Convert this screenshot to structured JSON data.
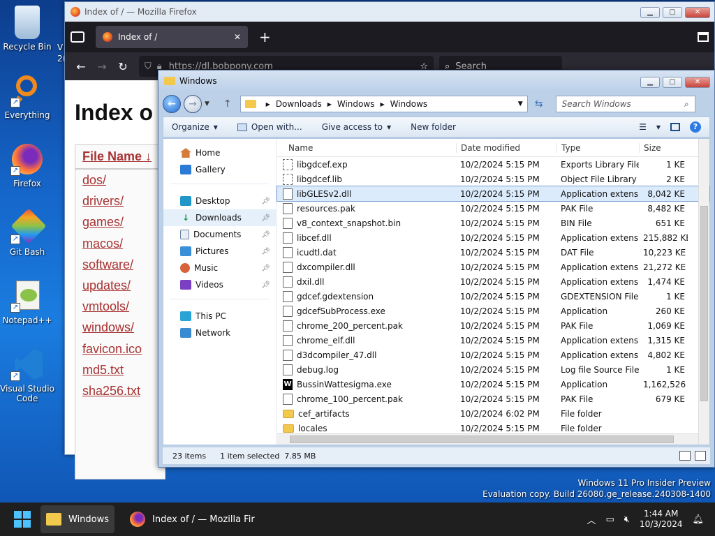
{
  "desktop": {
    "icons": [
      {
        "label": "Recycle Bin"
      },
      {
        "label": "Everything"
      },
      {
        "label": "Firefox"
      },
      {
        "label": "Git Bash"
      },
      {
        "label": "Notepad++"
      },
      {
        "label": "Visual Studio Code"
      }
    ],
    "partial_label": "V\n2(",
    "watermark_line1": "Windows 11 Pro Insider Preview",
    "watermark_line2": "Evaluation copy. Build 26080.ge_release.240308-1400"
  },
  "firefox": {
    "window_title": "Index of / — Mozilla Firefox",
    "tab_title": "Index of /",
    "url": "https://dl.bobpony.com",
    "search_placeholder": "Search",
    "page_heading": "Index o",
    "column_header": "File Name  ↓",
    "links": [
      "dos/",
      "drivers/",
      "games/",
      "macos/",
      "software/",
      "updates/",
      "vmtools/",
      "windows/",
      "favicon.ico",
      "md5.txt",
      "sha256.txt"
    ]
  },
  "explorer": {
    "title": "Windows",
    "breadcrumb": [
      "Downloads",
      "Windows",
      "Windows"
    ],
    "search_placeholder": "Search Windows",
    "toolbar": {
      "organize": "Organize",
      "open_with": "Open with...",
      "give_access": "Give access to",
      "new_folder": "New folder"
    },
    "nav": {
      "home": "Home",
      "gallery": "Gallery",
      "desktop": "Desktop",
      "downloads": "Downloads",
      "documents": "Documents",
      "pictures": "Pictures",
      "music": "Music",
      "videos": "Videos",
      "this_pc": "This PC",
      "network": "Network"
    },
    "columns": {
      "name": "Name",
      "date": "Date modified",
      "type": "Type",
      "size": "Size"
    },
    "files": [
      {
        "name": "libgdcef.exp",
        "date": "10/2/2024 5:15 PM",
        "type": "Exports Library File",
        "size": "1 KE",
        "icon": "gear"
      },
      {
        "name": "libgdcef.lib",
        "date": "10/2/2024 5:15 PM",
        "type": "Object File Library",
        "size": "2 KE",
        "icon": "gear"
      },
      {
        "name": "libGLESv2.dll",
        "date": "10/2/2024 5:15 PM",
        "type": "Application extens...",
        "size": "8,042 KE",
        "icon": "file"
      },
      {
        "name": "resources.pak",
        "date": "10/2/2024 5:15 PM",
        "type": "PAK File",
        "size": "8,482 KE",
        "icon": "file"
      },
      {
        "name": "v8_context_snapshot.bin",
        "date": "10/2/2024 5:15 PM",
        "type": "BIN File",
        "size": "651 KE",
        "icon": "file"
      },
      {
        "name": "libcef.dll",
        "date": "10/2/2024 5:15 PM",
        "type": "Application extens...",
        "size": "215,882 KE",
        "icon": "file"
      },
      {
        "name": "icudtl.dat",
        "date": "10/2/2024 5:15 PM",
        "type": "DAT File",
        "size": "10,223 KE",
        "icon": "file"
      },
      {
        "name": "dxcompiler.dll",
        "date": "10/2/2024 5:15 PM",
        "type": "Application extens...",
        "size": "21,272 KE",
        "icon": "file"
      },
      {
        "name": "dxil.dll",
        "date": "10/2/2024 5:15 PM",
        "type": "Application extens...",
        "size": "1,474 KE",
        "icon": "file"
      },
      {
        "name": "gdcef.gdextension",
        "date": "10/2/2024 5:15 PM",
        "type": "GDEXTENSION File",
        "size": "1 KE",
        "icon": "file"
      },
      {
        "name": "gdcefSubProcess.exe",
        "date": "10/2/2024 5:15 PM",
        "type": "Application",
        "size": "260 KE",
        "icon": "file"
      },
      {
        "name": "chrome_200_percent.pak",
        "date": "10/2/2024 5:15 PM",
        "type": "PAK File",
        "size": "1,069 KE",
        "icon": "file"
      },
      {
        "name": "chrome_elf.dll",
        "date": "10/2/2024 5:15 PM",
        "type": "Application extens...",
        "size": "1,315 KE",
        "icon": "file"
      },
      {
        "name": "d3dcompiler_47.dll",
        "date": "10/2/2024 5:15 PM",
        "type": "Application extens...",
        "size": "4,802 KE",
        "icon": "file"
      },
      {
        "name": "debug.log",
        "date": "10/2/2024 5:15 PM",
        "type": "Log file Source File",
        "size": "1 KE",
        "icon": "file"
      },
      {
        "name": "BussinWattesigma.exe",
        "date": "10/2/2024 5:15 PM",
        "type": "Application",
        "size": "1,162,526 KE",
        "icon": "app"
      },
      {
        "name": "chrome_100_percent.pak",
        "date": "10/2/2024 5:15 PM",
        "type": "PAK File",
        "size": "679 KE",
        "icon": "file"
      },
      {
        "name": "cef_artifacts",
        "date": "10/2/2024 6:02 PM",
        "type": "File folder",
        "size": "",
        "icon": "folder"
      },
      {
        "name": "locales",
        "date": "10/2/2024 5:15 PM",
        "type": "File folder",
        "size": "",
        "icon": "folder"
      }
    ],
    "selected_index": 2,
    "status_count": "23 items",
    "status_selected": "1 item selected  7.85 MB"
  },
  "taskbar": {
    "explorer_label": "Windows",
    "firefox_label": "Index of / — Mozilla Fir",
    "time": "1:44 AM",
    "date": "10/3/2024"
  }
}
